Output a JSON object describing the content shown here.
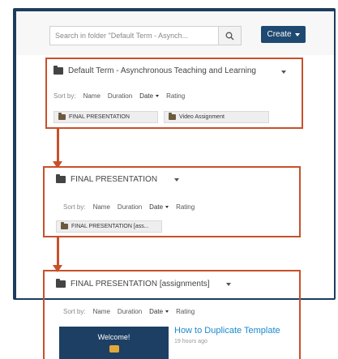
{
  "search": {
    "placeholder": "Search in folder \"Default Term - Asynch..."
  },
  "toolbar": {
    "create_label": "Create"
  },
  "panels": [
    {
      "title": "Default Term - Asynchronous Teaching and Learning",
      "sort": {
        "label": "Sort by:",
        "options": [
          "Name",
          "Duration",
          "Date",
          "Rating"
        ],
        "active": "Date"
      },
      "items": [
        "FINAL PRESENTATION",
        "Video Assignment"
      ]
    },
    {
      "title": "FINAL PRESENTATION",
      "sort": {
        "label": "Sort by:",
        "options": [
          "Name",
          "Duration",
          "Date",
          "Rating"
        ],
        "active": "Date"
      },
      "items": [
        "FINAL PRESENTATION [ass..."
      ]
    },
    {
      "title": "FINAL PRESENTATION [assignments]",
      "sort": {
        "label": "Sort by:",
        "options": [
          "Name",
          "Duration",
          "Date",
          "Rating"
        ],
        "active": "Date"
      },
      "video": {
        "thumbnail_text": "Welcome!",
        "title": "How to Duplicate Template",
        "meta": "19 hours ago"
      }
    }
  ],
  "colors": {
    "frame": "#1c3d5e",
    "callout_border": "#c8502a",
    "create_button": "#1f4970",
    "link": "#1a8ad0"
  },
  "icons": [
    "search-icon",
    "folder-icon",
    "chevron-down-icon"
  ]
}
